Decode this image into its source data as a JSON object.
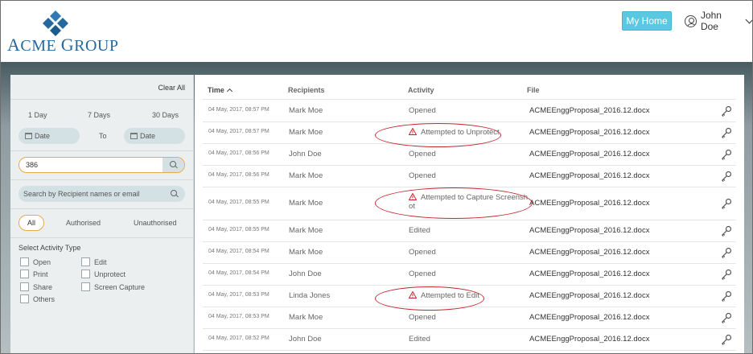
{
  "header": {
    "brand_prefix_big": "A",
    "brand_rest1": "CME ",
    "brand_g_big": "G",
    "brand_rest2": "ROUP",
    "my_home_label": "My Home",
    "user_name": "John Doe"
  },
  "sidebar": {
    "clear_all": "Clear All",
    "ranges": [
      "1 Day",
      "7 Days",
      "30 Days"
    ],
    "date_from": "Date",
    "to_label": "To",
    "date_to": "Date",
    "search_value": "386",
    "recipient_search_placeholder": "Search by Recipient names or email",
    "filter_all": "All",
    "filter_authorised": "Authorised",
    "filter_unauthorised": "Unauthorised",
    "activity_type_title": "Select Activity Type",
    "activity_types": [
      "Open",
      "Print",
      "Share",
      "Others",
      "Edit",
      "Unprotect",
      "Screen Capture"
    ]
  },
  "table": {
    "headers": {
      "time": "Time",
      "recipients": "Recipients",
      "activity": "Activity",
      "file": "File"
    },
    "rows": [
      {
        "time": "04 May, 2017, 08:57 PM",
        "recipient": "Mark Moe",
        "activity": "Opened",
        "file": "ACMEEnggProposal_2016.12.docx",
        "warning": false
      },
      {
        "time": "04 May, 2017, 08:57 PM",
        "recipient": "Mark Moe",
        "activity": "Attempted to Unprotect",
        "file": "ACMEEnggProposal_2016.12.docx",
        "warning": true
      },
      {
        "time": "04 May, 2017, 08:56 PM",
        "recipient": "John Doe",
        "activity": "Opened",
        "file": "ACMEEnggProposal_2016.12.docx",
        "warning": false
      },
      {
        "time": "04 May, 2017, 08:56 PM",
        "recipient": "Mark Moe",
        "activity": "Opened",
        "file": "ACMEEnggProposal_2016.12.docx",
        "warning": false
      },
      {
        "time": "04 May, 2017, 08:55 PM",
        "recipient": "Mark Moe",
        "activity": "Attempted to Capture Screensh",
        "activity_line2": "ot",
        "file": "ACMEEnggProposal_2016.12.docx",
        "warning": true
      },
      {
        "time": "04 May, 2017, 08:55 PM",
        "recipient": "Mark Moe",
        "activity": "Edited",
        "file": "ACMEEnggProposal_2016.12.docx",
        "warning": false
      },
      {
        "time": "04 May, 2017, 08:54 PM",
        "recipient": "Mark Moe",
        "activity": "Opened",
        "file": "ACMEEnggProposal_2016.12.docx",
        "warning": false
      },
      {
        "time": "04 May, 2017, 08:54 PM",
        "recipient": "John Doe",
        "activity": "Opened",
        "file": "ACMEEnggProposal_2016.12.docx",
        "warning": false
      },
      {
        "time": "04 May, 2017, 08:53 PM",
        "recipient": "Linda Jones",
        "activity": "Attempted to Edit",
        "file": "ACMEEnggProposal_2016.12.docx",
        "warning": true
      },
      {
        "time": "04 May, 2017, 08:53 PM",
        "recipient": "Mark Moe",
        "activity": "Opened",
        "file": "ACMEEnggProposal_2016.12.docx",
        "warning": false
      },
      {
        "time": "04 May, 2017, 08:52 PM",
        "recipient": "John Doe",
        "activity": "Edited",
        "file": "ACMEEnggProposal_2016.12.docx",
        "warning": false
      }
    ]
  },
  "colors": {
    "accent": "#5bc8e2",
    "brand": "#2369a0",
    "highlight_ring": "#c4262e",
    "warning": "#c4262e"
  }
}
